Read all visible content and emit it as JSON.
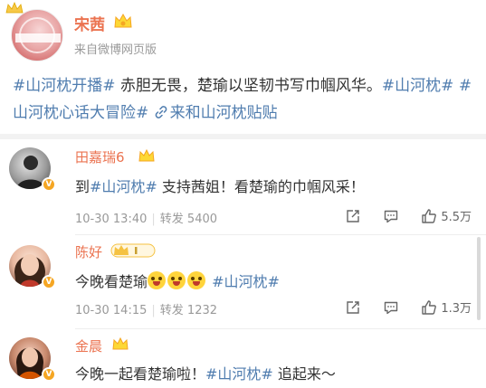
{
  "post": {
    "author": "宋茜",
    "source": "来自微博网页版",
    "segments": [
      {
        "text": "#山河枕开播#",
        "type": "tag"
      },
      {
        "text": " 赤胆无畏，楚瑜以坚韧书写巾帼风华。",
        "type": "text"
      },
      {
        "text": "#山河枕#",
        "type": "tag"
      },
      {
        "text": " ",
        "type": "text"
      },
      {
        "text": "#山河枕心话大冒险#",
        "type": "tag"
      },
      {
        "text": " ",
        "type": "text"
      },
      {
        "text": "来和山河枕贴贴",
        "type": "link"
      }
    ]
  },
  "comments": [
    {
      "name": "田嘉瑞6",
      "text_prefix": "到",
      "tag": "#山河枕#",
      "text_suffix": " 支持茜姐！看楚瑜的巾帼风采！",
      "time": "10-30 13:40",
      "repost_label": "转发",
      "repost_count": "5400",
      "like_count": "5.5万"
    },
    {
      "name": "陈好",
      "text_prefix": "今晚看楚瑜",
      "tag": "#山河枕#",
      "time": "10-30 14:15",
      "repost_label": "转发",
      "repost_count": "1232",
      "like_count": "1.3万"
    },
    {
      "name": "金晨",
      "text_prefix": "今晚一起看楚瑜啦！",
      "tag": "#山河枕#",
      "text_suffix": " 追起来～"
    }
  ],
  "colors": {
    "name": "#eb7350",
    "tag": "#507daf",
    "meta": "#999999"
  },
  "icons": [
    "crown-icon",
    "vip-badge-icon",
    "link-icon",
    "share-icon",
    "comment-icon",
    "like-icon",
    "verified-icon",
    "emoji-icon"
  ]
}
